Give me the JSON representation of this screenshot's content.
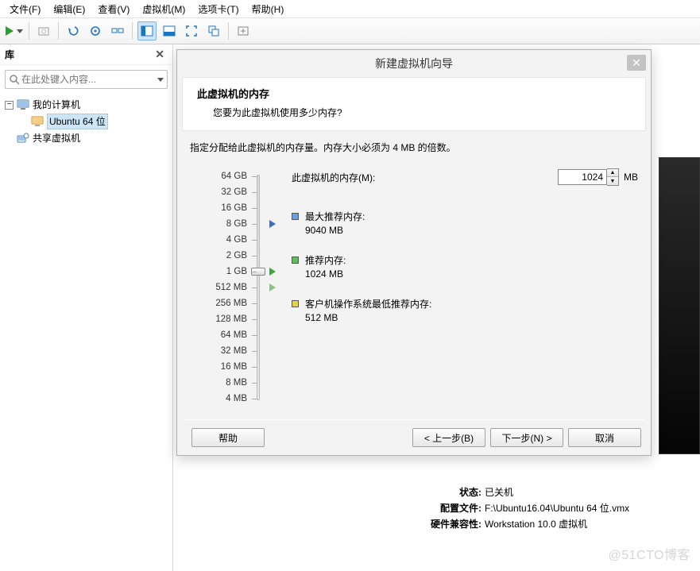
{
  "menu": {
    "file": "文件(F)",
    "edit": "编辑(E)",
    "view": "查看(V)",
    "vm": "虚拟机(M)",
    "tabs": "选项卡(T)",
    "help": "帮助(H)"
  },
  "sidebar": {
    "title": "库",
    "search_placeholder": "在此处键入内容...",
    "root": "我的计算机",
    "item": "Ubuntu 64 位",
    "shared": "共享虚拟机"
  },
  "dialog": {
    "title": "新建虚拟机向导",
    "heading": "此虚拟机的内存",
    "subheading": "您要为此虚拟机使用多少内存?",
    "instruction": "指定分配给此虚拟机的内存量。内存大小必须为 4 MB 的倍数。",
    "mem_label": "此虚拟机的内存(M):",
    "mem_value": "1024",
    "mem_unit": "MB",
    "ticks": [
      "64 GB",
      "32 GB",
      "16 GB",
      "8 GB",
      "4 GB",
      "2 GB",
      "1 GB",
      "512 MB",
      "256 MB",
      "128 MB",
      "64 MB",
      "32 MB",
      "16 MB",
      "8 MB",
      "4 MB"
    ],
    "rec_max_label": "最大推荐内存:",
    "rec_max_value": "9040 MB",
    "rec_label": "推荐内存:",
    "rec_value": "1024 MB",
    "rec_min_label": "客户机操作系统最低推荐内存:",
    "rec_min_value": "512 MB",
    "btn_help": "帮助",
    "btn_back": "< 上一步(B)",
    "btn_next": "下一步(N) >",
    "btn_cancel": "取消"
  },
  "status": {
    "state_label": "状态:",
    "state_value": "已关机",
    "config_label": "配置文件:",
    "config_value": "F:\\Ubuntu16.04\\Ubuntu 64 位.vmx",
    "hw_label": "硬件兼容性:",
    "hw_value": "Workstation 10.0 虚拟机"
  },
  "watermark": "@51CTO博客"
}
